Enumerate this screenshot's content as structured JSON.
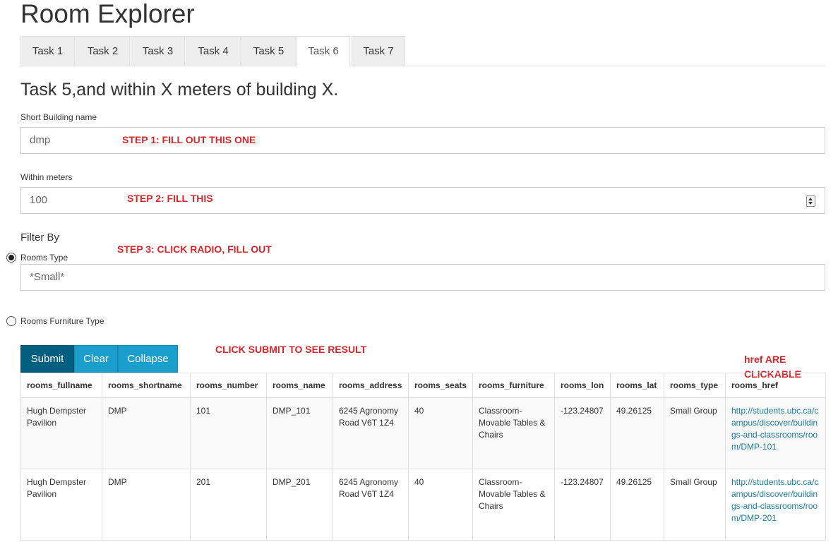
{
  "app": {
    "title": "Room Explorer"
  },
  "tabs": [
    {
      "label": "Task 1",
      "active": false
    },
    {
      "label": "Task 2",
      "active": false
    },
    {
      "label": "Task 3",
      "active": false
    },
    {
      "label": "Task 4",
      "active": false
    },
    {
      "label": "Task 5",
      "active": false
    },
    {
      "label": "Task 6",
      "active": true
    },
    {
      "label": "Task 7",
      "active": false
    }
  ],
  "form": {
    "heading": "Task 5,and within X meters of building X.",
    "building": {
      "label": "Short Building name",
      "value": "dmp",
      "note": "STEP 1: FILL OUT THIS ONE"
    },
    "meters": {
      "label": "Within meters",
      "value": "100",
      "note": "STEP 2: FILL THIS"
    },
    "filter": {
      "label": "Filter By",
      "note": "STEP 3: CLICK RADIO, FILL OUT",
      "rooms_type_label": "Rooms Type",
      "rooms_type_value": "*Small*",
      "rooms_furniture_label": "Rooms Furniture Type",
      "selected": "rooms_type"
    },
    "buttons": {
      "submit": "Submit",
      "clear": "Clear",
      "collapse": "Collapse"
    },
    "submit_note": "CLICK SUBMIT TO SEE RESULT",
    "href_note": "href ARE\nCLICKABLE"
  },
  "table": {
    "columns": [
      "rooms_fullname",
      "rooms_shortname",
      "rooms_number",
      "rooms_name",
      "rooms_address",
      "rooms_seats",
      "rooms_furniture",
      "rooms_lon",
      "rooms_lat",
      "rooms_type",
      "rooms_href"
    ],
    "rows": [
      [
        "Hugh Dempster Pavilion",
        "DMP",
        "101",
        "DMP_101",
        "6245 Agronomy Road V6T 1Z4",
        "40",
        "Classroom-Movable Tables & Chairs",
        "-123.24807",
        "49.26125",
        "Small Group",
        "http://students.ubc.ca/campus/discover/buildings-and-classrooms/room/DMP-101"
      ],
      [
        "Hugh Dempster Pavilion",
        "DMP",
        "201",
        "DMP_201",
        "6245 Agronomy Road V6T 1Z4",
        "40",
        "Classroom-Movable Tables & Chairs",
        "-123.24807",
        "49.26125",
        "Small Group",
        "http://students.ubc.ca/campus/discover/buildings-and-classrooms/room/DMP-201"
      ]
    ]
  },
  "colors": {
    "accent_dark": "#005f80",
    "accent": "#1a9ecb",
    "note_red": "#d9262c",
    "link": "#1a7ca6"
  }
}
